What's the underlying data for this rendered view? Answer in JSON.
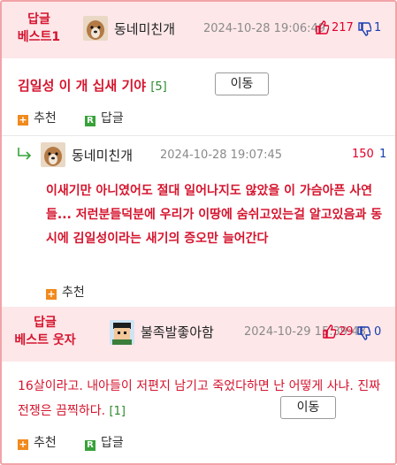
{
  "post": {
    "rank_label": "답글\n베스트1",
    "author": "동네미친개",
    "datetime": "2024-10-28 19:06:49",
    "up_count": "217",
    "down_count": "1",
    "title": "김일성 이 개 십새 기야",
    "reply_count": "[5]",
    "move_button": "이동",
    "recommend_label": "추천",
    "reply_label": "답글"
  },
  "comment": {
    "author": "동네미친개",
    "datetime": "2024-10-28 19:07:45",
    "up_count": "150",
    "down_count": "1",
    "text": "이새기만 아니였어도 절대 일어나지도 않았을 이 가슴아픈 사연들... 저런분들덕분에 우리가 이땅에 숨쉬고있는걸 알고있음과 동시에 김일성이라는 새기의 증오만 늘어간다",
    "recommend_label": "추천"
  },
  "post2": {
    "rank_label": "답글\n베스트 웃자",
    "author": "불족발좋아함",
    "datetime": "2024-10-29 15:39:43",
    "up_count": "29",
    "down_count": "0",
    "text": "16살이라고. 내아들이 저편지 남기고 죽었다하면 난 어떻게 사냐. 진짜 전쟁은 끔찍하다.",
    "reply_count": "[1]",
    "move_button": "이동",
    "recommend_label": "추천",
    "reply_label": "답글"
  },
  "colors": {
    "accent": "#d5152e",
    "pink_bg": "#fde7e9",
    "border": "#f2a3a8"
  },
  "icons": [
    "thumbs-up-icon",
    "thumbs-down-icon",
    "reply-arrow-icon",
    "plus-icon",
    "reply-r-icon"
  ]
}
